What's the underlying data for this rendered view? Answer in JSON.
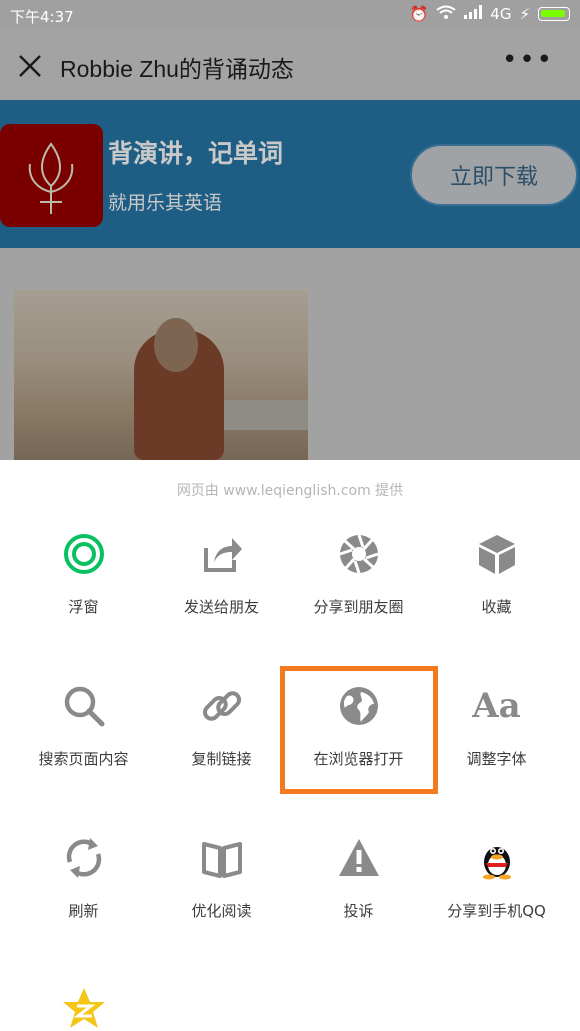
{
  "status_bar": {
    "time": "下午4:37",
    "network": "4G"
  },
  "header": {
    "title": "Robbie Zhu的背诵动态"
  },
  "banner": {
    "headline": "背演讲，记单词",
    "subline": "就用乐其英语",
    "download_label": "立即下载"
  },
  "sheet": {
    "provider": "网页由 www.leqienglish.com 提供",
    "items": [
      {
        "label": "浮窗",
        "icon": "floating-window-icon"
      },
      {
        "label": "发送给朋友",
        "icon": "share-forward-icon"
      },
      {
        "label": "分享到朋友圈",
        "icon": "moments-icon"
      },
      {
        "label": "收藏",
        "icon": "favorite-cube-icon"
      },
      {
        "label": "搜索页面内容",
        "icon": "search-icon"
      },
      {
        "label": "复制链接",
        "icon": "link-icon"
      },
      {
        "label": "在浏览器打开",
        "icon": "globe-icon"
      },
      {
        "label": "调整字体",
        "icon": "font-icon",
        "glyph": "Aa"
      },
      {
        "label": "刷新",
        "icon": "refresh-icon"
      },
      {
        "label": "优化阅读",
        "icon": "book-icon"
      },
      {
        "label": "投诉",
        "icon": "warning-icon"
      },
      {
        "label": "分享到手机QQ",
        "icon": "qq-icon"
      },
      {
        "label": "",
        "icon": "qzone-star-icon"
      }
    ]
  },
  "colors": {
    "accent_green": "#07c160",
    "highlight": "#f47a20",
    "icon_gray": "#8a8a8a"
  }
}
